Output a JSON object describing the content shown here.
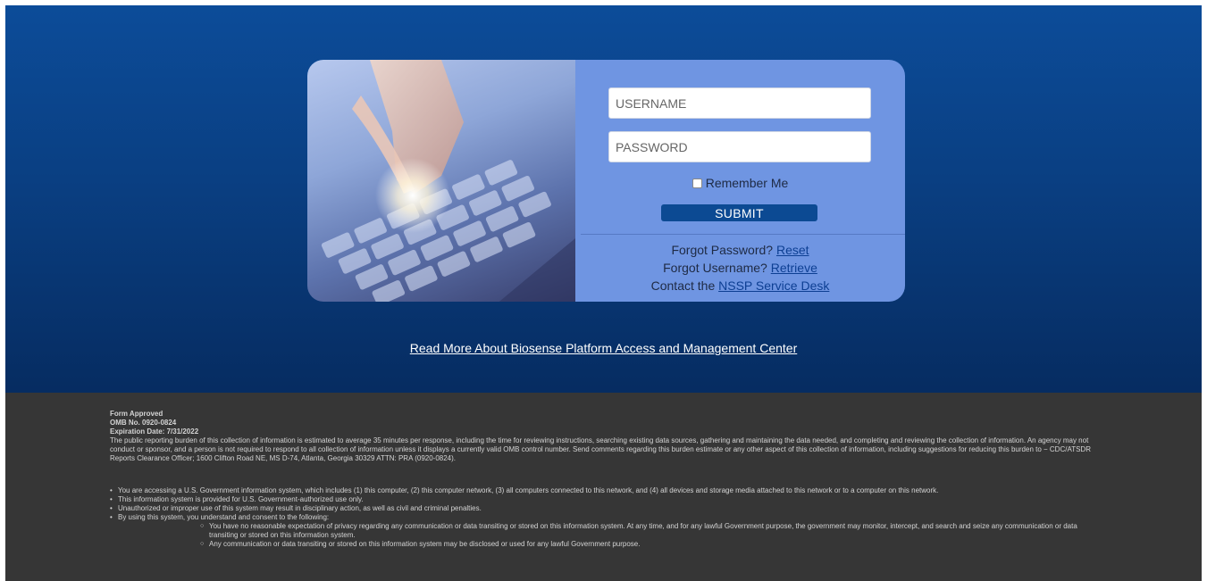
{
  "login": {
    "username_placeholder": "USERNAME",
    "password_placeholder": "PASSWORD",
    "remember_label": "Remember Me",
    "submit_label": "SUBMIT",
    "forgot_password_text": "Forgot Password? ",
    "forgot_password_link": "Reset",
    "forgot_username_text": "Forgot Username? ",
    "forgot_username_link": "Retrieve",
    "contact_text": "Contact the ",
    "contact_link": "NSSP Service Desk"
  },
  "read_more_link": "Read More About Biosense Platform Access and Management Center",
  "footer": {
    "form_approved": "Form Approved",
    "omb_number": "OMB No. 0920-0824",
    "expiration": "Expiration Date: 7/31/2022",
    "burden_statement": "The public reporting burden of this collection of information is estimated to average 35 minutes per response, including the time for reviewing instructions, searching existing data sources, gathering and maintaining the data needed, and completing and reviewing the collection of information. An agency may not conduct or sponsor, and a person is not required to respond to all collection of information unless it displays a currently valid OMB control number. Send comments regarding this burden estimate or any other aspect of this collection of information, including suggestions for reducing this burden to − CDC/ATSDR Reports Clearance Officer; 1600 Clifton Road NE, MS D-74, Atlanta, Georgia 30329 ATTN: PRA (0920-0824).",
    "notices": [
      "You are accessing a U.S. Government information system, which includes (1) this computer, (2) this computer network, (3) all computers connected to this network, and (4) all devices and storage media attached to this network or to a computer on this network.",
      "This information system is provided for U.S. Government-authorized use only.",
      "Unauthorized or improper use of this system may result in disciplinary action, as well as civil and criminal penalties.",
      "By using this system, you understand and consent to the following:"
    ],
    "consent_items": [
      "You have no reasonable expectation of privacy regarding any communication or data transiting or stored on this information system. At any time, and for any lawful Government purpose, the government may monitor, intercept, and search and seize any communication or data transiting or stored on this information system.",
      "Any communication or data transiting or stored on this information system may be disclosed or used for any lawful Government purpose."
    ]
  },
  "colors": {
    "hero_blue": "#0a3f82",
    "card_form_blue": "#6f95e2",
    "submit_blue": "#0c4a93",
    "footer_gray": "#363636"
  }
}
